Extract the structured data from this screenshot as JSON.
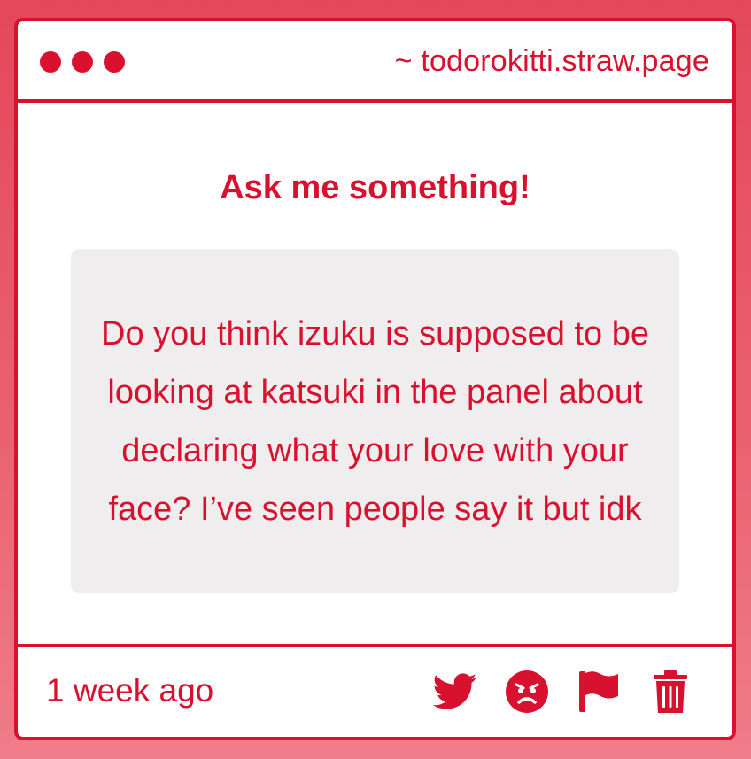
{
  "window": {
    "url": "~ todorokitti.straw.page"
  },
  "main": {
    "heading": "Ask me something!",
    "question": "Do you think izuku is supposed to be looking at katsuki in the panel about declaring what your love with your face? I’ve seen people say it but idk"
  },
  "footer": {
    "timestamp": "1 week ago",
    "actions": [
      {
        "icon": "twitter-icon"
      },
      {
        "icon": "angry-face-icon"
      },
      {
        "icon": "flag-icon"
      },
      {
        "icon": "trash-icon"
      }
    ]
  },
  "colors": {
    "accent": "#d8112e",
    "box": "#efedee",
    "background": "#e4475a"
  }
}
